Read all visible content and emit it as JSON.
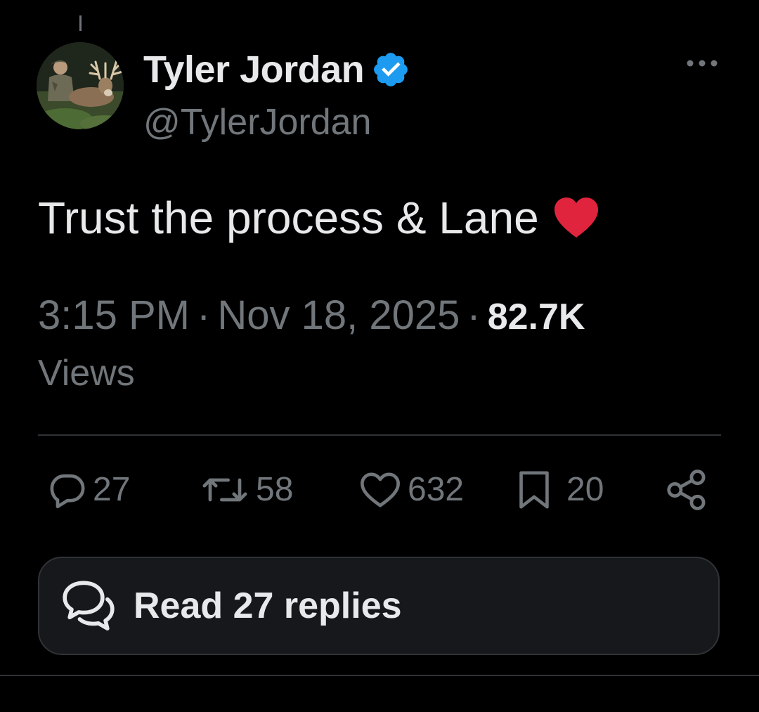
{
  "author": {
    "display_name": "Tyler Jordan",
    "handle": "@TylerJordan",
    "verified": true,
    "verified_color": "#1d9bf0"
  },
  "tweet": {
    "text": "Trust the process & Lane",
    "emoji": "red-heart",
    "emoji_color": "#e0243d",
    "time": "3:15 PM",
    "date": "Nov 18, 2025",
    "separator": "·",
    "views_count": "82.7K",
    "views_label": "Views"
  },
  "actions": {
    "replies": "27",
    "reposts": "58",
    "likes": "632",
    "bookmarks": "20"
  },
  "read_replies": {
    "label": "Read 27 replies"
  },
  "icons": {
    "reply": "reply-icon",
    "repost": "repost-icon",
    "like": "heart-icon",
    "bookmark": "bookmark-icon",
    "share": "share-icon",
    "more": "more-options-icon",
    "read_replies": "speech-bubbles-icon"
  },
  "colors": {
    "background": "#000000",
    "primary_text": "#e7e9ea",
    "secondary_text": "#71767b",
    "divider": "#2f3336"
  }
}
